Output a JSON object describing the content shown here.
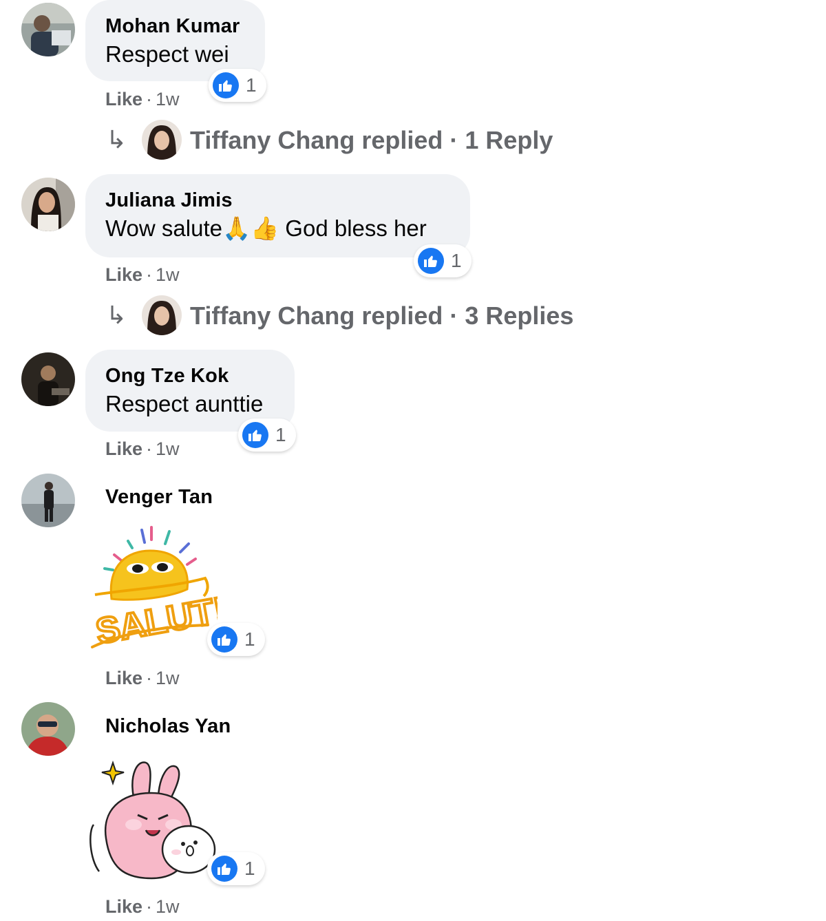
{
  "comments": [
    {
      "author": "Mohan Kumar",
      "text": "Respect wei",
      "like_label": "Like",
      "separator": "·",
      "time": "1w",
      "reaction_count": "1",
      "reply": {
        "arrow": "↳",
        "text": "Tiffany Chang replied · 1 Reply"
      }
    },
    {
      "author": "Juliana Jimis",
      "text": "Wow salute🙏👍 God bless her",
      "like_label": "Like",
      "separator": "·",
      "time": "1w",
      "reaction_count": "1",
      "reply": {
        "arrow": "↳",
        "text": "Tiffany Chang replied · 3 Replies"
      }
    },
    {
      "author": "Ong Tze Kok",
      "text": "Respect aunttie",
      "like_label": "Like",
      "separator": "·",
      "time": "1w",
      "reaction_count": "1"
    },
    {
      "author": "Venger Tan",
      "sticker_text": "SALUT!",
      "like_label": "Like",
      "separator": "·",
      "time": "1w",
      "reaction_count": "1"
    },
    {
      "author": "Nicholas Yan",
      "like_label": "Like",
      "separator": "·",
      "time": "1w",
      "reaction_count": "1"
    }
  ],
  "colors": {
    "bubble": "#f0f2f5",
    "like_blue": "#1877f2",
    "meta_gray": "#65676b",
    "text": "#050505"
  },
  "icons": {
    "like_reaction": "thumbs-up-icon",
    "reply": "reply-arrow-icon"
  }
}
